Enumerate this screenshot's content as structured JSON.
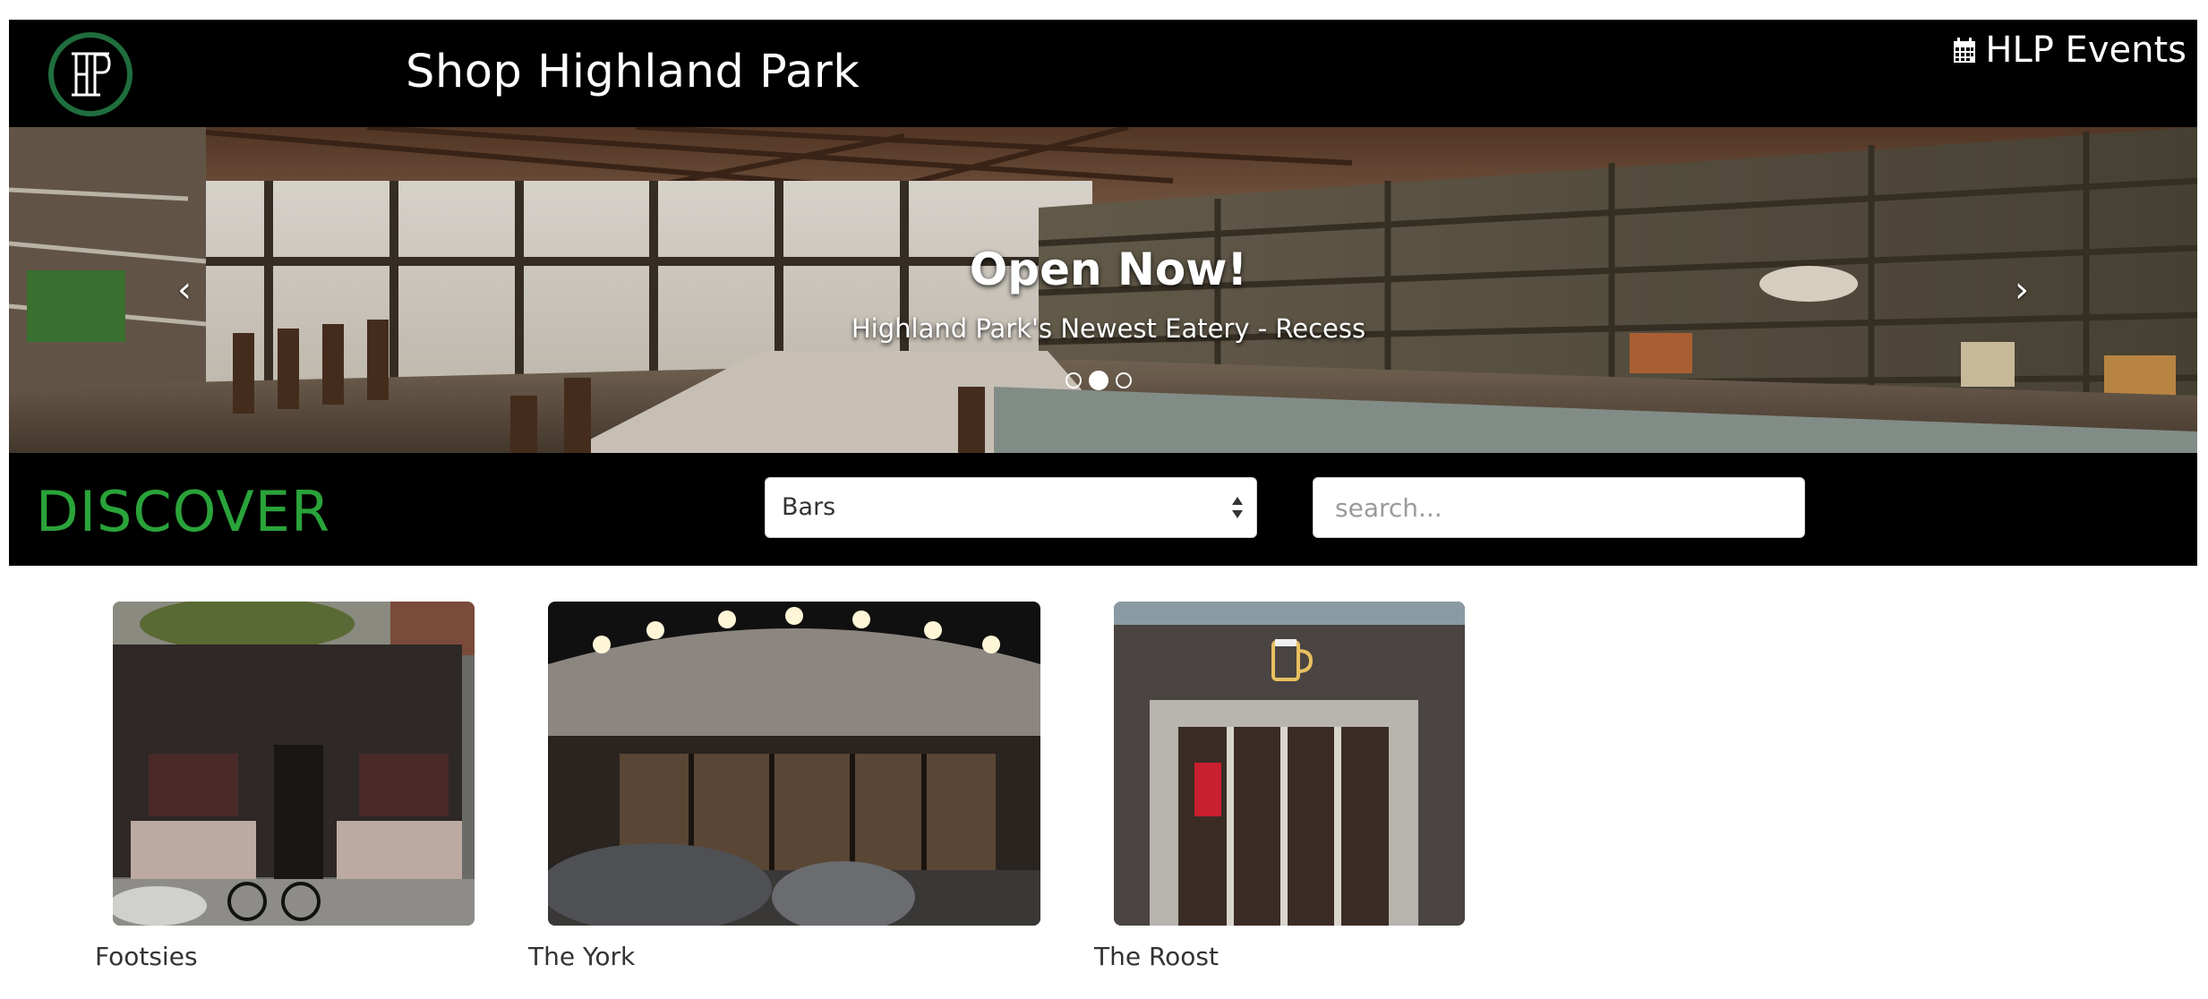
{
  "header": {
    "title": "Shop Highland Park",
    "logo_text": "HP",
    "events_label": "HLP Events",
    "events_icon": "calendar-icon"
  },
  "carousel": {
    "title": "Open Now!",
    "subtitle": "Highland Park's Newest Eatery - Recess",
    "prev_label": "‹",
    "next_label": "›",
    "slide_count": 3,
    "active_slide": 1
  },
  "discover": {
    "title": "DISCOVER",
    "category_selected": "Bars",
    "search_placeholder": "search..."
  },
  "results": [
    {
      "name": "Footsies"
    },
    {
      "name": "The York"
    },
    {
      "name": "The Roost"
    }
  ],
  "colors": {
    "header_bg": "#000000",
    "discover_accent": "#2aa33a",
    "logo_ring": "#1f6e3e"
  }
}
